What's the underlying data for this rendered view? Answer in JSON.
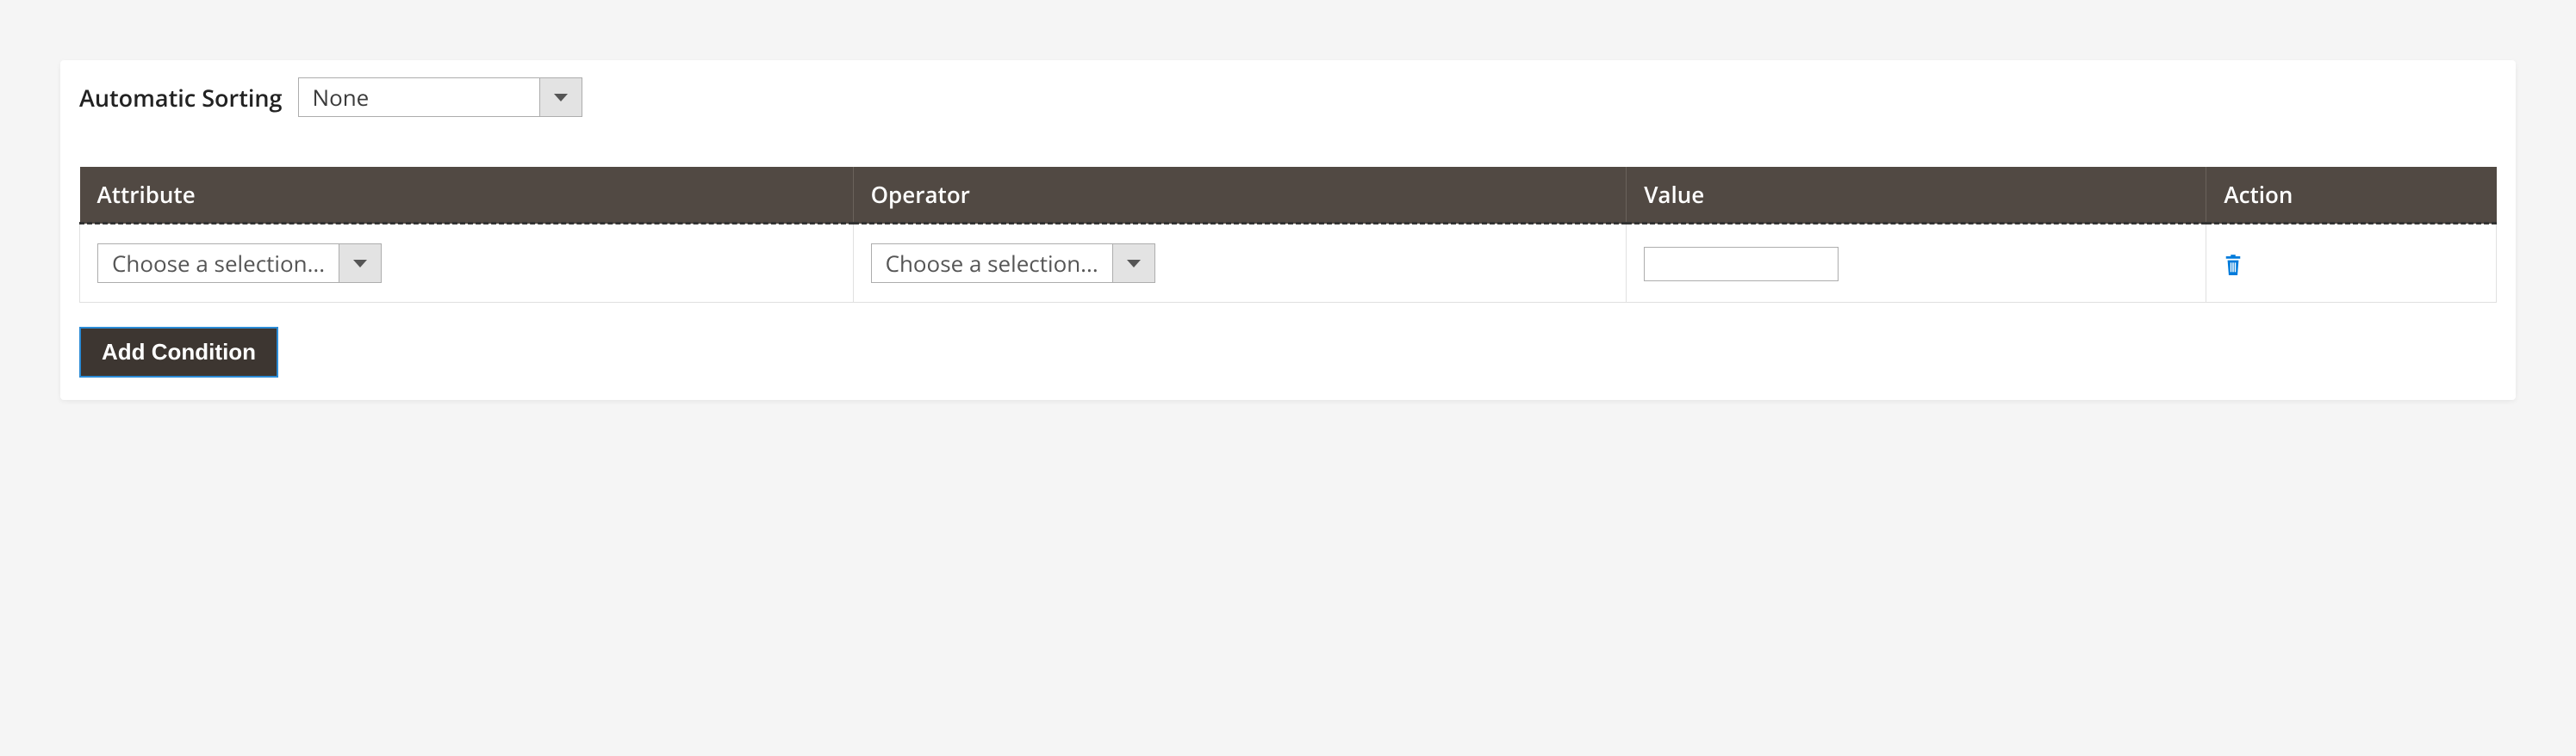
{
  "sorting": {
    "label": "Automatic Sorting",
    "selected": "None"
  },
  "columns": {
    "attribute": "Attribute",
    "operator": "Operator",
    "value": "Value",
    "action": "Action"
  },
  "row": {
    "attribute_placeholder": "Choose a selection...",
    "operator_placeholder": "Choose a selection...",
    "value": "",
    "action_icon": "trash-icon"
  },
  "buttons": {
    "add_condition": "Add Condition"
  },
  "colors": {
    "header_bg": "#514943",
    "accent_blue": "#007bdb"
  },
  "column_widths": {
    "attribute": "32%",
    "operator": "32%",
    "value": "24%",
    "action": "12%"
  }
}
